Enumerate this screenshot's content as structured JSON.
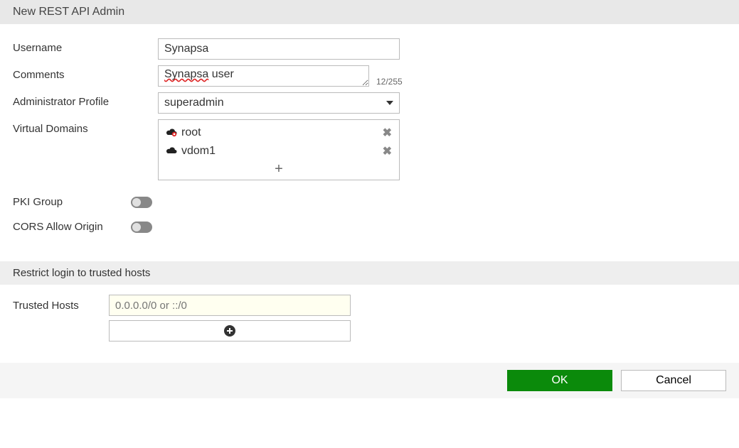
{
  "header": {
    "title": "New REST API Admin"
  },
  "form": {
    "username_label": "Username",
    "username_value": "Synapsa",
    "comments_label": "Comments",
    "comments_value_pre": "Synapsa",
    "comments_value_post": " user",
    "comments_count": "12/255",
    "admin_profile_label": "Administrator Profile",
    "admin_profile_value": "superadmin",
    "vdom_label": "Virtual Domains",
    "vdom_items": [
      {
        "name": "root",
        "icon": "cloud-shared"
      },
      {
        "name": "vdom1",
        "icon": "cloud"
      }
    ],
    "vdom_add_glyph": "+",
    "pki_label": "PKI Group",
    "pki_on": false,
    "cors_label": "CORS Allow Origin",
    "cors_on": false
  },
  "restrict": {
    "section_title": "Restrict login to trusted hosts",
    "trusted_label": "Trusted Hosts",
    "trusted_placeholder": "0.0.0.0/0 or ::/0"
  },
  "footer": {
    "ok": "OK",
    "cancel": "Cancel"
  }
}
